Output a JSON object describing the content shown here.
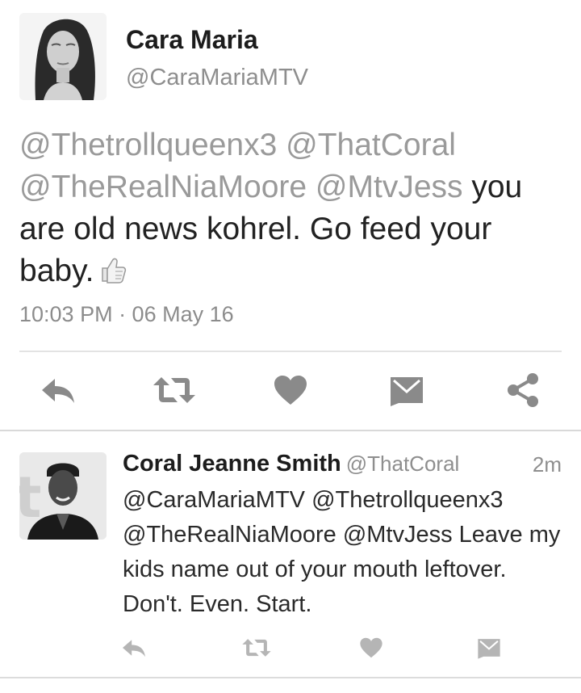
{
  "main_tweet": {
    "author_name": "Cara Maria",
    "author_handle": "@CaraMariaMTV",
    "text_segments": [
      {
        "text": "@Thetrollqueenx3 ",
        "kind": "mention"
      },
      {
        "text": "@ThatCoral",
        "kind": "mention"
      },
      {
        "text": " ",
        "kind": "plain"
      },
      {
        "text": "@TheRealNiaMoore ",
        "kind": "mention"
      },
      {
        "text": "@MtvJess",
        "kind": "mention"
      },
      {
        "text": " you are old news kohrel. Go feed your baby.",
        "kind": "plain"
      }
    ],
    "emoji": "thumbs-up",
    "timestamp": "10:03 PM · 06 May 16",
    "actions": [
      "reply-icon",
      "retweet-icon",
      "like-icon",
      "message-icon",
      "share-icon"
    ]
  },
  "reply_tweet": {
    "author_name": "Coral Jeanne Smith",
    "author_handle": "@ThatCoral",
    "time_ago": "2m",
    "text": "@CaraMariaMTV @Thetrollqueenx3 @TheRealNiaMoore @MtvJess Leave my kids name out of your mouth leftover. Don't. Even. Start.",
    "actions": [
      "reply-icon",
      "retweet-icon",
      "like-icon",
      "message-icon"
    ]
  },
  "colors": {
    "mention": "#9a9a9a",
    "icon": "#8a8a8a",
    "icon_light": "#b5b5b5",
    "divider": "#e3e3e3"
  }
}
